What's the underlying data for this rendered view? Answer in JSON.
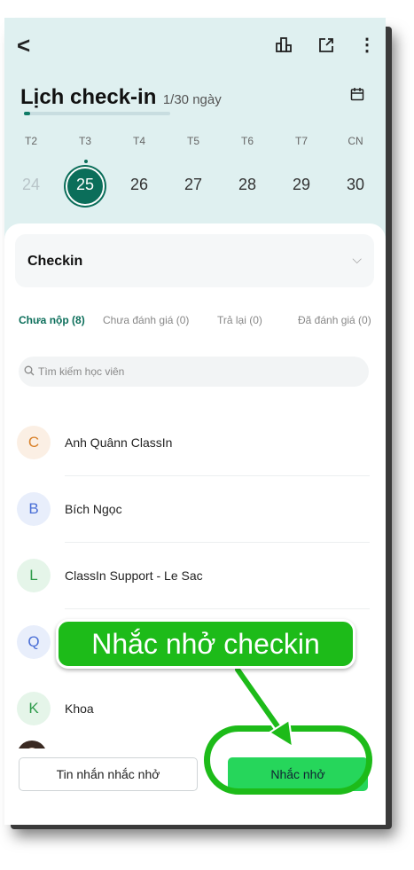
{
  "header": {
    "title": "Lịch check-in",
    "progress_text": "1/30 ngày",
    "progress_fraction": 0.033
  },
  "calendar": {
    "weekdays": [
      "T2",
      "T3",
      "T4",
      "T5",
      "T6",
      "T7",
      "CN"
    ],
    "dates": [
      "24",
      "25",
      "26",
      "27",
      "28",
      "29",
      "30"
    ],
    "selected_index": 1
  },
  "task_select": {
    "label": "Checkin"
  },
  "tabs": [
    {
      "label": "Chưa nộp (8)",
      "active": true
    },
    {
      "label": "Chưa đánh giá (0)",
      "active": false
    },
    {
      "label": "Trả lại (0)",
      "active": false
    },
    {
      "label": "Đã đánh giá (0)",
      "active": false
    }
  ],
  "search": {
    "placeholder": "Tìm kiếm học viên"
  },
  "students": [
    {
      "initial": "C",
      "name": "Anh Quânn ClassIn",
      "color": "#d9822b",
      "bg": "#fbefe4"
    },
    {
      "initial": "B",
      "name": "Bích Ngọc",
      "color": "#4a6fd6",
      "bg": "#e8eefb"
    },
    {
      "initial": "L",
      "name": "ClassIn Support - Le Sac",
      "color": "#2e9b4a",
      "bg": "#e5f5e9"
    },
    {
      "initial": "Q",
      "name": "",
      "color": "#4a6fd6",
      "bg": "#e8eefb"
    },
    {
      "initial": "K",
      "name": "Khoa",
      "color": "#2e9b4a",
      "bg": "#e5f5e9"
    }
  ],
  "bottom_bar": {
    "reminder_message_label": "Tin nhắn nhắc nhở",
    "remind_label": "Nhắc nhở"
  },
  "annotation": {
    "callout_text": "Nhắc nhở checkin"
  },
  "colors": {
    "accent": "#0b6e5a",
    "primary_button": "#26d65b",
    "annotation_green": "#1dbb19"
  }
}
